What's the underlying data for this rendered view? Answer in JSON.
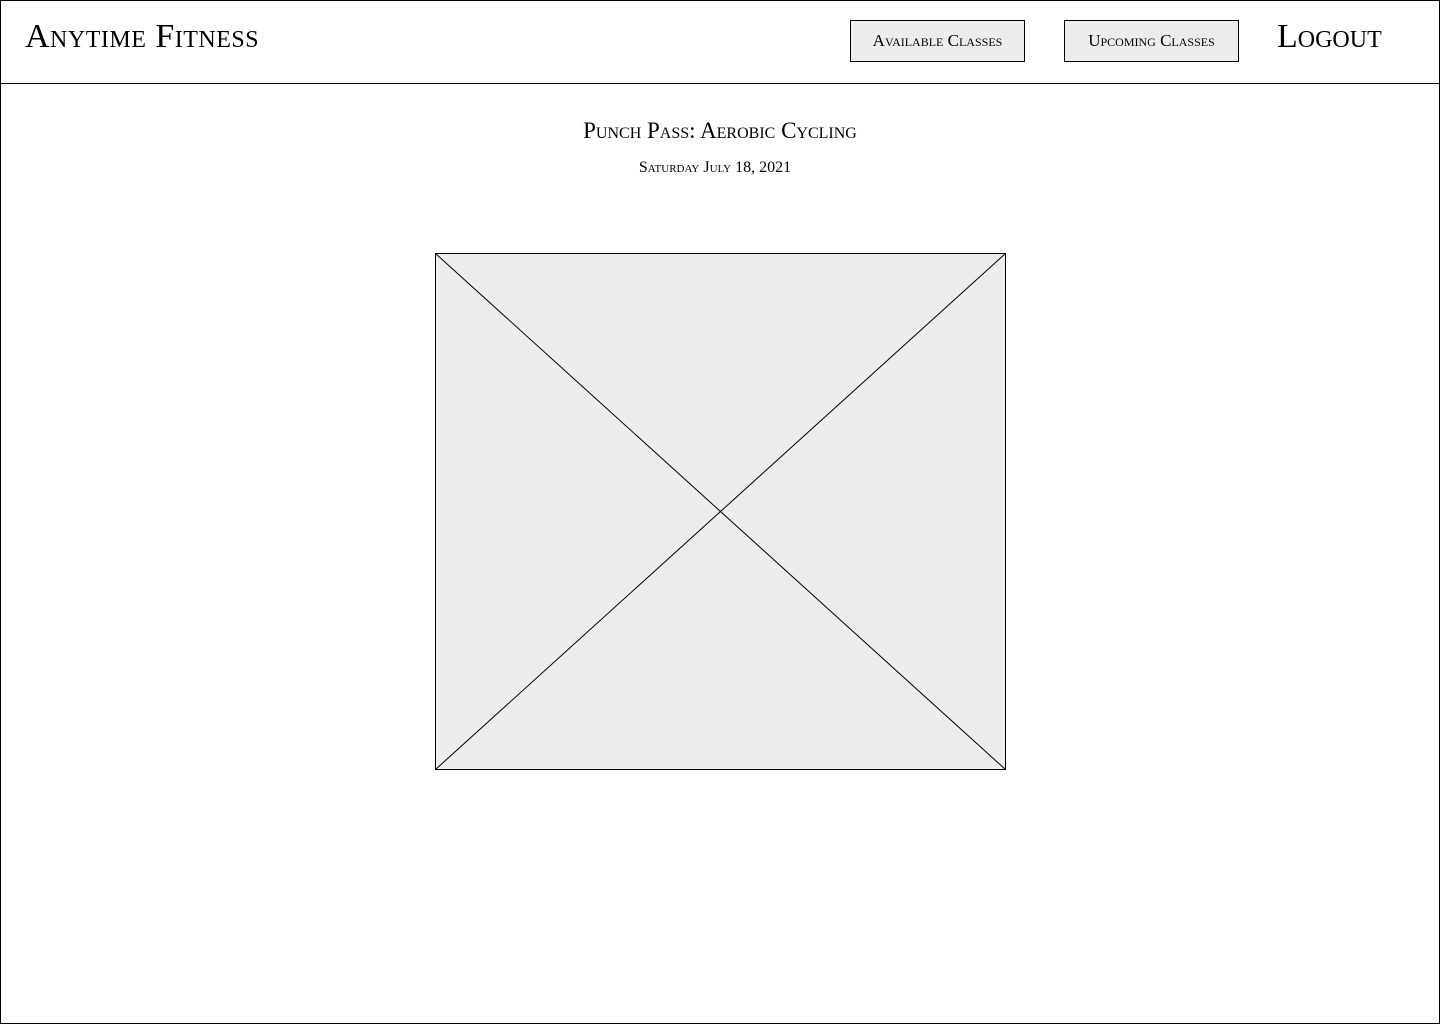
{
  "header": {
    "brand": "Anytime Fitness",
    "nav": {
      "available_classes": "Available Classes",
      "upcoming_classes": "Upcoming Classes"
    },
    "logout": "Logout"
  },
  "main": {
    "title": "Punch Pass: Aerobic Cycling",
    "date": "Saturday July 18, 2021",
    "image": {
      "icon": "image-placeholder-icon",
      "fill_color": "#ededee"
    }
  }
}
